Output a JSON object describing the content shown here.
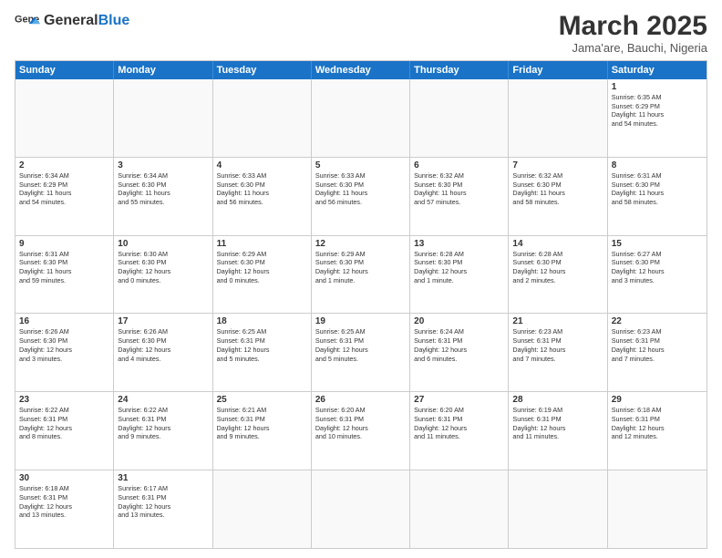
{
  "header": {
    "logo_general": "General",
    "logo_blue": "Blue",
    "month_title": "March 2025",
    "location": "Jama'are, Bauchi, Nigeria"
  },
  "weekdays": [
    "Sunday",
    "Monday",
    "Tuesday",
    "Wednesday",
    "Thursday",
    "Friday",
    "Saturday"
  ],
  "rows": [
    [
      {
        "day": "",
        "info": ""
      },
      {
        "day": "",
        "info": ""
      },
      {
        "day": "",
        "info": ""
      },
      {
        "day": "",
        "info": ""
      },
      {
        "day": "",
        "info": ""
      },
      {
        "day": "",
        "info": ""
      },
      {
        "day": "1",
        "info": "Sunrise: 6:35 AM\nSunset: 6:29 PM\nDaylight: 11 hours\nand 54 minutes."
      }
    ],
    [
      {
        "day": "2",
        "info": "Sunrise: 6:34 AM\nSunset: 6:29 PM\nDaylight: 11 hours\nand 54 minutes."
      },
      {
        "day": "3",
        "info": "Sunrise: 6:34 AM\nSunset: 6:30 PM\nDaylight: 11 hours\nand 55 minutes."
      },
      {
        "day": "4",
        "info": "Sunrise: 6:33 AM\nSunset: 6:30 PM\nDaylight: 11 hours\nand 56 minutes."
      },
      {
        "day": "5",
        "info": "Sunrise: 6:33 AM\nSunset: 6:30 PM\nDaylight: 11 hours\nand 56 minutes."
      },
      {
        "day": "6",
        "info": "Sunrise: 6:32 AM\nSunset: 6:30 PM\nDaylight: 11 hours\nand 57 minutes."
      },
      {
        "day": "7",
        "info": "Sunrise: 6:32 AM\nSunset: 6:30 PM\nDaylight: 11 hours\nand 58 minutes."
      },
      {
        "day": "8",
        "info": "Sunrise: 6:31 AM\nSunset: 6:30 PM\nDaylight: 11 hours\nand 58 minutes."
      }
    ],
    [
      {
        "day": "9",
        "info": "Sunrise: 6:31 AM\nSunset: 6:30 PM\nDaylight: 11 hours\nand 59 minutes."
      },
      {
        "day": "10",
        "info": "Sunrise: 6:30 AM\nSunset: 6:30 PM\nDaylight: 12 hours\nand 0 minutes."
      },
      {
        "day": "11",
        "info": "Sunrise: 6:29 AM\nSunset: 6:30 PM\nDaylight: 12 hours\nand 0 minutes."
      },
      {
        "day": "12",
        "info": "Sunrise: 6:29 AM\nSunset: 6:30 PM\nDaylight: 12 hours\nand 1 minute."
      },
      {
        "day": "13",
        "info": "Sunrise: 6:28 AM\nSunset: 6:30 PM\nDaylight: 12 hours\nand 1 minute."
      },
      {
        "day": "14",
        "info": "Sunrise: 6:28 AM\nSunset: 6:30 PM\nDaylight: 12 hours\nand 2 minutes."
      },
      {
        "day": "15",
        "info": "Sunrise: 6:27 AM\nSunset: 6:30 PM\nDaylight: 12 hours\nand 3 minutes."
      }
    ],
    [
      {
        "day": "16",
        "info": "Sunrise: 6:26 AM\nSunset: 6:30 PM\nDaylight: 12 hours\nand 3 minutes."
      },
      {
        "day": "17",
        "info": "Sunrise: 6:26 AM\nSunset: 6:30 PM\nDaylight: 12 hours\nand 4 minutes."
      },
      {
        "day": "18",
        "info": "Sunrise: 6:25 AM\nSunset: 6:31 PM\nDaylight: 12 hours\nand 5 minutes."
      },
      {
        "day": "19",
        "info": "Sunrise: 6:25 AM\nSunset: 6:31 PM\nDaylight: 12 hours\nand 5 minutes."
      },
      {
        "day": "20",
        "info": "Sunrise: 6:24 AM\nSunset: 6:31 PM\nDaylight: 12 hours\nand 6 minutes."
      },
      {
        "day": "21",
        "info": "Sunrise: 6:23 AM\nSunset: 6:31 PM\nDaylight: 12 hours\nand 7 minutes."
      },
      {
        "day": "22",
        "info": "Sunrise: 6:23 AM\nSunset: 6:31 PM\nDaylight: 12 hours\nand 7 minutes."
      }
    ],
    [
      {
        "day": "23",
        "info": "Sunrise: 6:22 AM\nSunset: 6:31 PM\nDaylight: 12 hours\nand 8 minutes."
      },
      {
        "day": "24",
        "info": "Sunrise: 6:22 AM\nSunset: 6:31 PM\nDaylight: 12 hours\nand 9 minutes."
      },
      {
        "day": "25",
        "info": "Sunrise: 6:21 AM\nSunset: 6:31 PM\nDaylight: 12 hours\nand 9 minutes."
      },
      {
        "day": "26",
        "info": "Sunrise: 6:20 AM\nSunset: 6:31 PM\nDaylight: 12 hours\nand 10 minutes."
      },
      {
        "day": "27",
        "info": "Sunrise: 6:20 AM\nSunset: 6:31 PM\nDaylight: 12 hours\nand 11 minutes."
      },
      {
        "day": "28",
        "info": "Sunrise: 6:19 AM\nSunset: 6:31 PM\nDaylight: 12 hours\nand 11 minutes."
      },
      {
        "day": "29",
        "info": "Sunrise: 6:18 AM\nSunset: 6:31 PM\nDaylight: 12 hours\nand 12 minutes."
      }
    ],
    [
      {
        "day": "30",
        "info": "Sunrise: 6:18 AM\nSunset: 6:31 PM\nDaylight: 12 hours\nand 13 minutes."
      },
      {
        "day": "31",
        "info": "Sunrise: 6:17 AM\nSunset: 6:31 PM\nDaylight: 12 hours\nand 13 minutes."
      },
      {
        "day": "",
        "info": ""
      },
      {
        "day": "",
        "info": ""
      },
      {
        "day": "",
        "info": ""
      },
      {
        "day": "",
        "info": ""
      },
      {
        "day": "",
        "info": ""
      }
    ]
  ]
}
